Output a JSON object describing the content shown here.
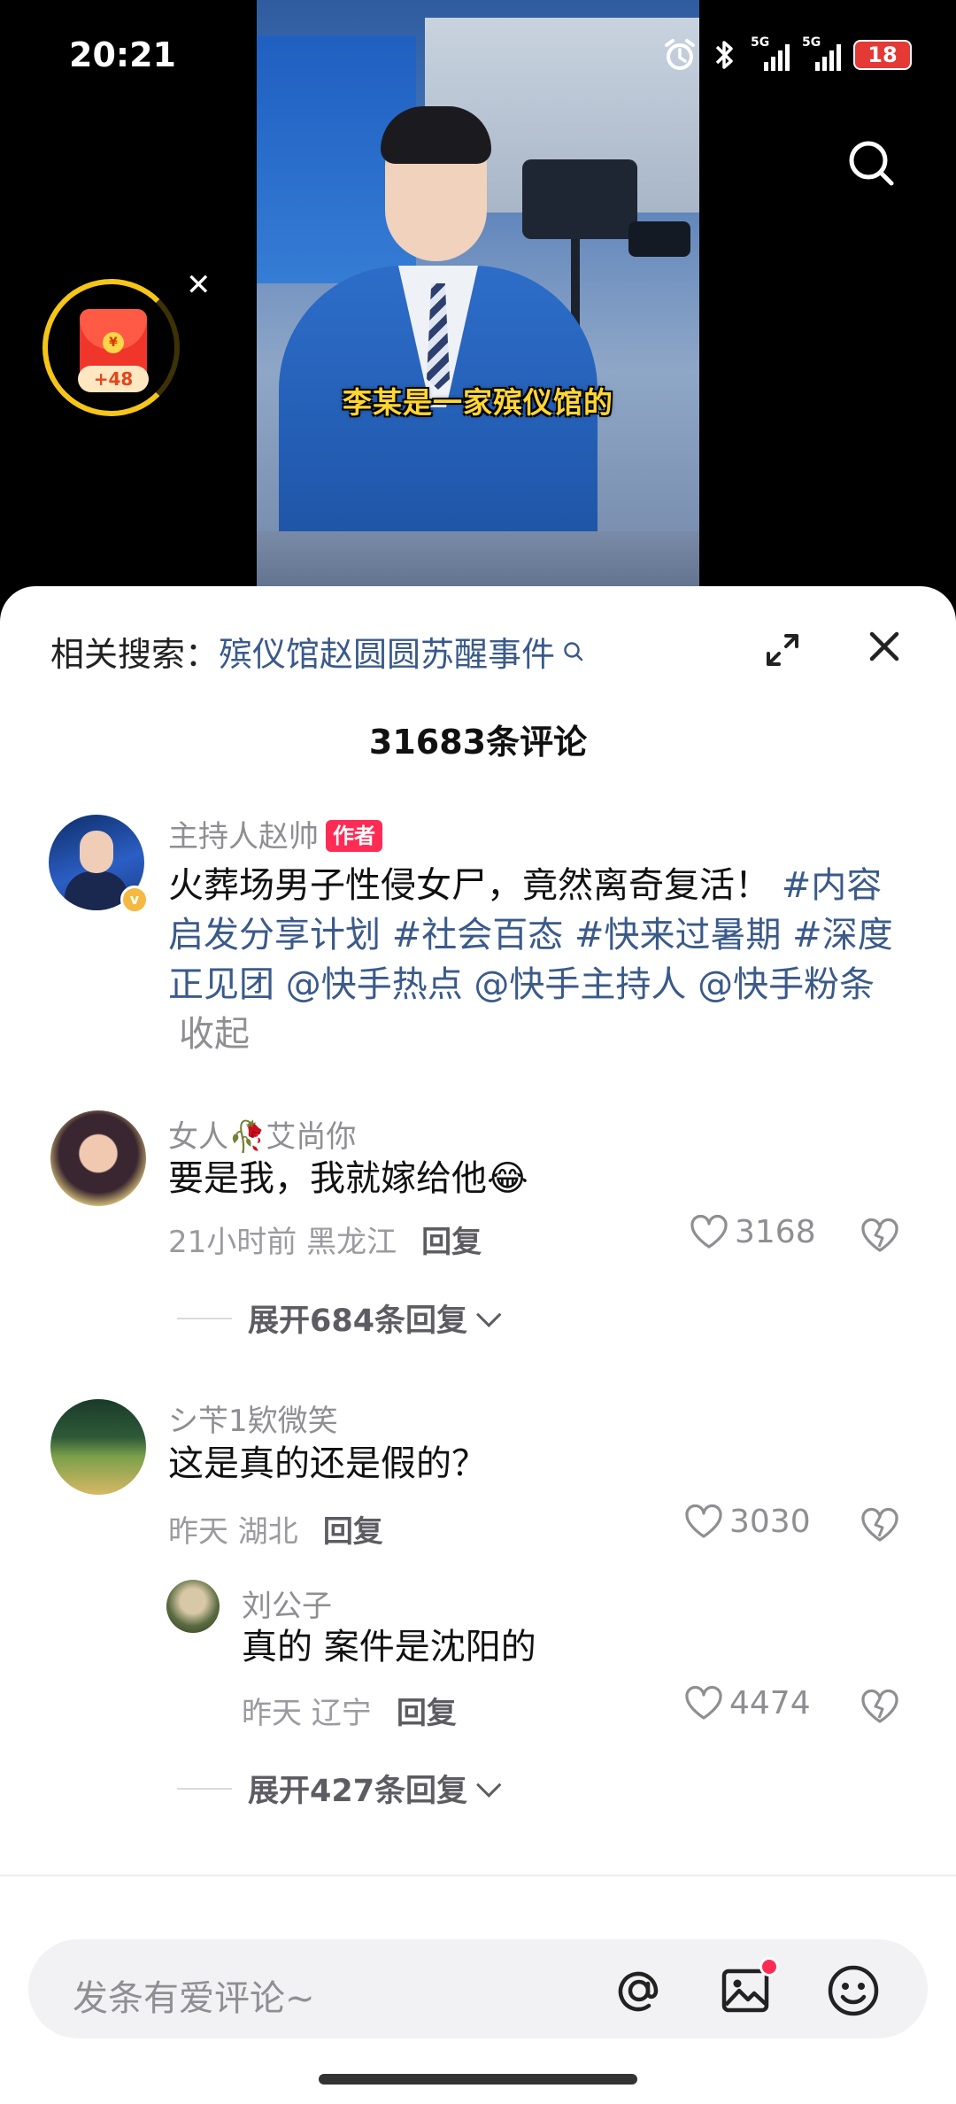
{
  "status_bar": {
    "time": "20:21",
    "signal_tag_1": "5G",
    "signal_tag_2": "5G",
    "battery": "18"
  },
  "video": {
    "subtitle": "李某是一家殡仪馆的",
    "red_packet_badge": "+48",
    "red_packet_coin": "¥"
  },
  "sheet": {
    "related_label": "相关搜索：",
    "related_keyword": "殡仪馆赵圆圆苏醒事件",
    "comment_count": "31683条评论"
  },
  "author_post": {
    "name": "主持人赵帅",
    "tag": "作者",
    "text_main": "火葬场男子性侵女尸，竟然离奇复活！",
    "hashtags": " #内容启发分享计划 #社会百态 #快来过暑期 #深度正见团 @快手热点 @快手主持人 @快手粉条",
    "collapse": "收起"
  },
  "comments": [
    {
      "name": "女人🥀艾尚你",
      "text": "要是我，我就嫁给他😂",
      "time_location": "21小时前 黑龙江",
      "reply": "回复",
      "likes": "3168",
      "expand": "展开684条回复"
    },
    {
      "name": "シ苄1欵微笑",
      "text": "这是真的还是假的？",
      "time_location": "昨天 湖北",
      "reply": "回复",
      "likes": "3030",
      "sub_reply": {
        "name": "刘公子",
        "text": "真的 案件是沈阳的",
        "time_location": "昨天 辽宁",
        "reply": "回复",
        "likes": "4474"
      },
      "expand": "展开427条回复"
    }
  ],
  "input": {
    "placeholder": "发条有爱评论~"
  },
  "colors": {
    "accent_red": "#fe2c55",
    "link_blue": "#3a5a8a",
    "subtitle_yellow": "#ffd633"
  },
  "icons": [
    "search-icon",
    "close-icon",
    "expand-icon",
    "heart-icon",
    "broken-heart-icon",
    "at-icon",
    "image-icon",
    "emoji-icon",
    "red-packet-icon"
  ]
}
